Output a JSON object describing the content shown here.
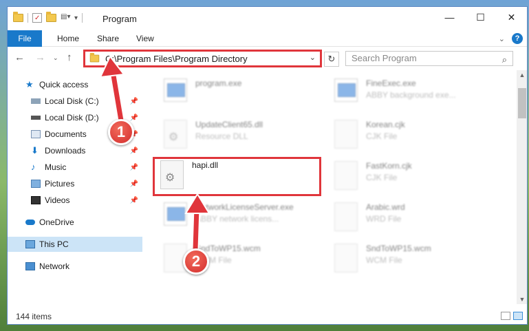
{
  "window": {
    "title": "Program",
    "minimize": "—",
    "maximize": "☐",
    "close": "✕"
  },
  "ribbon": {
    "tabs": [
      "File",
      "Home",
      "Share",
      "View"
    ],
    "help": "?"
  },
  "address": {
    "path": "C:\\Program Files\\Program Directory",
    "search_placeholder": "Search Program"
  },
  "nav": {
    "items": [
      {
        "label": "Quick access"
      },
      {
        "label": "Local Disk (C:)"
      },
      {
        "label": "Local Disk (D:)"
      },
      {
        "label": "Documents"
      },
      {
        "label": "Downloads"
      },
      {
        "label": "Music"
      },
      {
        "label": "Pictures"
      },
      {
        "label": "Videos"
      },
      {
        "label": "OneDrive"
      },
      {
        "label": "This PC"
      },
      {
        "label": "Network"
      }
    ]
  },
  "files": [
    {
      "name": "program.exe",
      "sub": ""
    },
    {
      "name": "FineExec.exe",
      "sub": "ABBY background exe..."
    },
    {
      "name": "UpdateClient65.dll",
      "sub": "Resource DLL"
    },
    {
      "name": "Korean.cjk",
      "sub": "CJK File"
    },
    {
      "name": "hapi.dll",
      "sub": ""
    },
    {
      "name": "FastKorn.cjk",
      "sub": "CJK File"
    },
    {
      "name": "NetworkLicenseServer.exe",
      "sub": "ABBY network licens..."
    },
    {
      "name": "Arabic.wrd",
      "sub": "WRD File"
    },
    {
      "name": "SndToWP15.wcm",
      "sub": "WCM File"
    },
    {
      "name": "SndToWP15.wcm",
      "sub": "WCM File"
    }
  ],
  "status": {
    "items": "144 items"
  },
  "annotations": {
    "badge1": "1",
    "badge2": "2"
  },
  "colors": {
    "accent": "#1979ca",
    "highlight": "#e0353b",
    "selected": "#cce4f7"
  }
}
